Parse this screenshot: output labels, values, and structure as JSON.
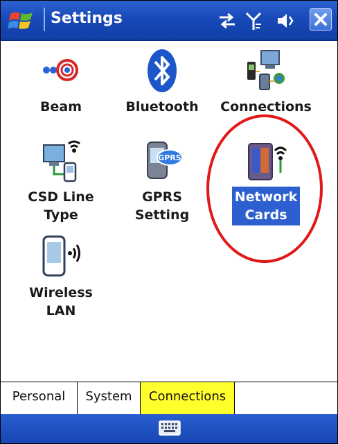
{
  "titlebar": {
    "title": "Settings",
    "start_icon": "windows-flag-icon",
    "status_icons": [
      "connectivity-arrows-icon",
      "signal-antenna-icon",
      "speaker-volume-icon"
    ],
    "close_label": "X"
  },
  "items": [
    {
      "label": "Beam",
      "icon": "beam-icon"
    },
    {
      "label": "Bluetooth",
      "icon": "bluetooth-icon"
    },
    {
      "label": "Connections",
      "icon": "connections-icon"
    },
    {
      "label": "CSD Line\nType",
      "icon": "csd-line-type-icon"
    },
    {
      "label": "GPRS\nSetting",
      "icon": "gprs-icon",
      "badge": "GPRS"
    },
    {
      "label": "Network\nCards",
      "icon": "network-cards-icon",
      "selected": true
    },
    {
      "label": "Wireless\nLAN",
      "icon": "wireless-lan-icon"
    }
  ],
  "tabs": [
    {
      "label": "Personal",
      "active": false
    },
    {
      "label": "System",
      "active": false
    },
    {
      "label": "Connections",
      "active": true
    }
  ],
  "cmdbar": {
    "keyboard_icon": "keyboard-icon"
  },
  "colors": {
    "titlebar": "#1849b8",
    "selection": "#2d5fd0",
    "active_tab": "#ffff2e",
    "highlight_ring": "#e01818"
  }
}
